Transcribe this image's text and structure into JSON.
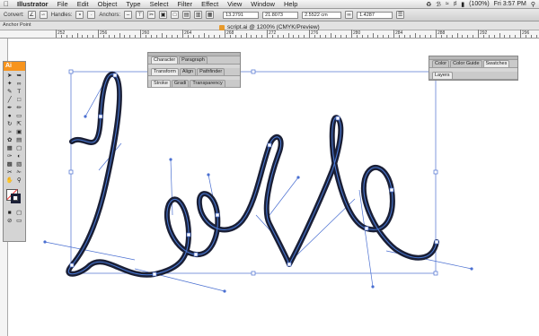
{
  "menubar": {
    "app": "Illustrator",
    "menus": [
      "File",
      "Edit",
      "Object",
      "Type",
      "Select",
      "Filter",
      "Effect",
      "View",
      "Window",
      "Help"
    ],
    "battery": "(100%)",
    "clock": "Fri 3:57 PM"
  },
  "control": {
    "convert_label": "Convert:",
    "handles_label": "Handles:",
    "anchors_label": "Anchors:",
    "x_value": "13.2791",
    "y_value": "21.8073",
    "w_value": "2.5522 cm",
    "h_value": "1.4287"
  },
  "status": {
    "anchor_point": "Anchor Point"
  },
  "ruler": {
    "labels": [
      "252",
      "256",
      "260",
      "264",
      "268",
      "272",
      "276",
      "280",
      "284",
      "288",
      "292",
      "296"
    ]
  },
  "document": {
    "title": "script.ai @ 1200% (CMYK/Preview)"
  },
  "toolbox": {
    "logo": "Ai"
  },
  "panels": {
    "char_tabs": [
      "Character",
      "Paragraph"
    ],
    "transform_tabs": [
      "Transform",
      "Align",
      "Pathfinder"
    ],
    "stroke_tabs": [
      "Stroke",
      "Gradi",
      "Transparency"
    ],
    "color_tabs": [
      "Color",
      "Color Guide",
      "Swatches"
    ],
    "layers_tabs": [
      "Layers"
    ]
  },
  "artwork": {
    "word": "Love",
    "stroke_color": "#1a1f36",
    "highlight_color": "#4a7bd8",
    "selection_color": "#4a6fd1"
  }
}
